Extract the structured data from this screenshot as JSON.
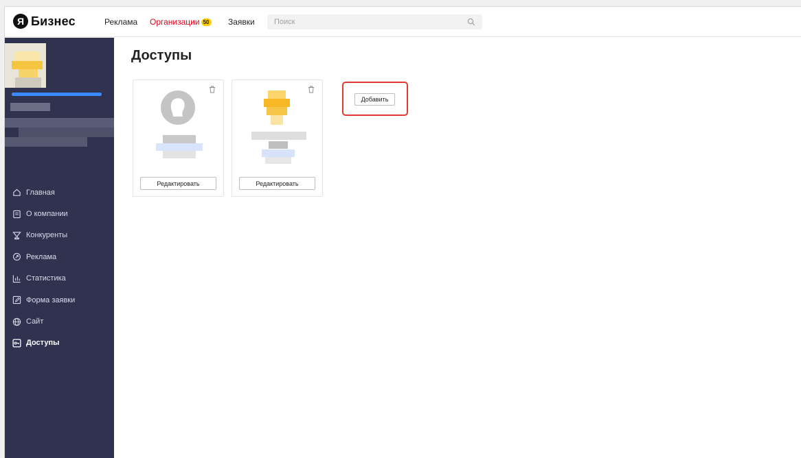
{
  "header": {
    "logo_mark": "Я",
    "logo_text": "Бизнес",
    "nav": [
      {
        "label": "Реклама"
      },
      {
        "label": "Организации",
        "badge": "50"
      },
      {
        "label": "Заявки"
      }
    ],
    "search_placeholder": "Поиск"
  },
  "sidebar": {
    "menu": [
      {
        "label": "Главная",
        "icon": "home-icon"
      },
      {
        "label": "О компании",
        "icon": "document-icon"
      },
      {
        "label": "Конкуренты",
        "icon": "trophy-icon"
      },
      {
        "label": "Реклама",
        "icon": "ads-icon"
      },
      {
        "label": "Статистика",
        "icon": "chart-icon"
      },
      {
        "label": "Форма заявки",
        "icon": "form-edit-icon"
      },
      {
        "label": "Сайт",
        "icon": "globe-icon"
      },
      {
        "label": "Доступы",
        "icon": "key-icon",
        "active": true
      }
    ]
  },
  "main": {
    "title": "Доступы",
    "cards": [
      {
        "edit_label": "Редактировать"
      },
      {
        "edit_label": "Редактировать"
      }
    ],
    "add_label": "Добавить"
  },
  "colors": {
    "sidebar_bg": "#2f3350",
    "accent_red": "#e0001a",
    "badge_yellow": "#ffcc00",
    "highlight_border": "#e03a30"
  }
}
